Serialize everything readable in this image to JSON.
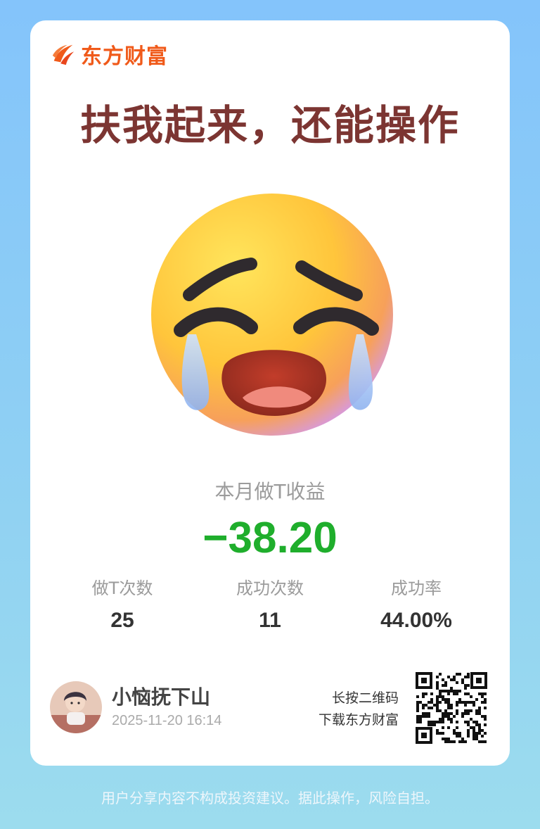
{
  "brand": {
    "name": "东方财富",
    "color": "#f05a1a"
  },
  "headline": "扶我起来，还能操作",
  "emoji": {
    "name": "crying-face-icon"
  },
  "metric": {
    "label": "本月做T收益",
    "value": "−38.20",
    "color": "#1fae2c"
  },
  "stats": [
    {
      "label": "做T次数",
      "value": "25"
    },
    {
      "label": "成功次数",
      "value": "11"
    },
    {
      "label": "成功率",
      "value": "44.00%"
    }
  ],
  "user": {
    "name": "小恼抚下山",
    "timestamp": "2025-11-20 16:14"
  },
  "qr_hint": {
    "line1": "长按二维码",
    "line2": "下载东方财富"
  },
  "disclaimer": "用户分享内容不构成投资建议。据此操作，风险自担。"
}
